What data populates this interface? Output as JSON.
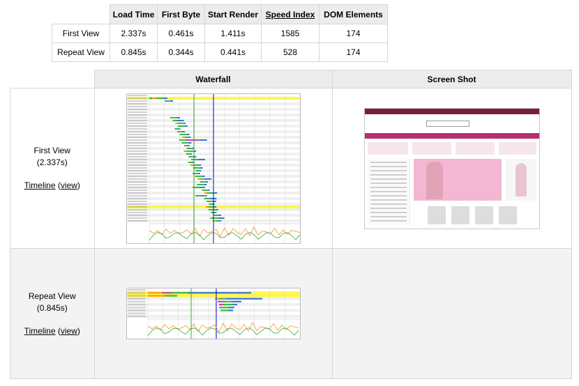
{
  "summary": {
    "headers": [
      "Load Time",
      "First Byte",
      "Start Render",
      "Speed Index",
      "DOM Elements"
    ],
    "rows": [
      {
        "label": "First View",
        "load_time": "2.337s",
        "first_byte": "0.461s",
        "start_render": "1.411s",
        "speed_index": "1585",
        "dom_elements": "174"
      },
      {
        "label": "Repeat View",
        "load_time": "0.845s",
        "first_byte": "0.344s",
        "start_render": "0.441s",
        "speed_index": "528",
        "dom_elements": "174"
      }
    ]
  },
  "results": {
    "headers": {
      "waterfall": "Waterfall",
      "screenshot": "Screen Shot"
    },
    "first_view": {
      "label": "First View",
      "time": "(2.337s)",
      "timeline": "Timeline",
      "view_open": "(",
      "view": "view",
      "view_close": ")"
    },
    "repeat_view": {
      "label": "Repeat View",
      "time": "(0.845s)",
      "timeline": "Timeline",
      "view_open": "(",
      "view": "view",
      "view_close": ")"
    }
  },
  "colors": {
    "highlight_row": "#fff64a",
    "dns": "#1ca8a8",
    "connect": "#ff9a00",
    "ssl": "#c041ad",
    "ttfb": "#38b843",
    "download": "#3b73d6",
    "start_render_line": "#2fad37",
    "onload_line": "#0000cc",
    "cpu_line": "#ff8f29",
    "bandwidth_line": "#2fad37"
  }
}
